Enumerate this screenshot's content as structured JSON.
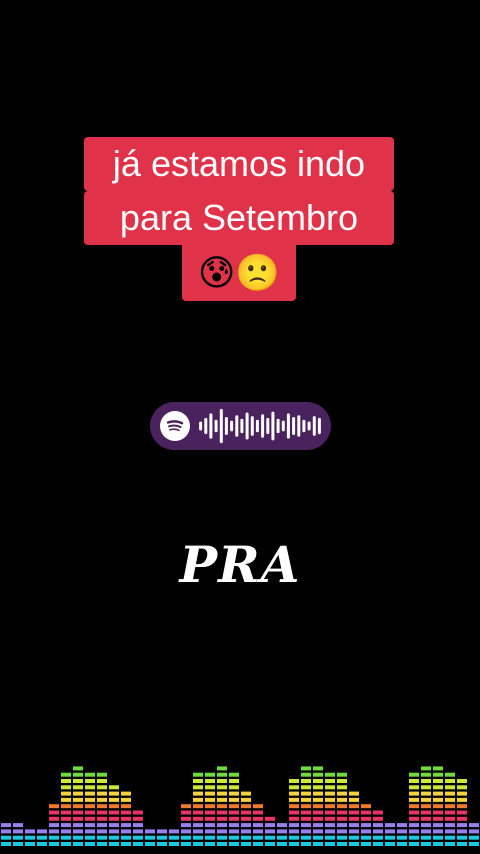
{
  "top_emojis": "😂😅",
  "caption": {
    "line1": "já estamos indo",
    "line2": "para Setembro",
    "emojis": "😰🙁"
  },
  "spotify_code": {
    "icon": "spotify-icon",
    "bar_levels": [
      0.25,
      0.45,
      0.7,
      0.35,
      0.95,
      0.5,
      0.3,
      0.6,
      0.4,
      0.75,
      0.55,
      0.35,
      0.65,
      0.45,
      0.8,
      0.4,
      0.3,
      0.7,
      0.5,
      0.6,
      0.35,
      0.25,
      0.55,
      0.45
    ],
    "background": "#4a235e"
  },
  "lyric": "PRA",
  "equalizer": {
    "colors": [
      "#1ac9e0",
      "#9a7ff0",
      "#e8336a",
      "#f07a2a",
      "#f5d23a",
      "#cde83a",
      "#6edc3a",
      "#2ad14a"
    ],
    "levels": [
      4,
      4,
      3,
      3,
      7,
      12,
      13,
      12,
      12,
      10,
      9,
      6,
      3,
      3,
      3,
      7,
      12,
      12,
      13,
      12,
      9,
      7,
      5,
      4,
      11,
      13,
      13,
      12,
      12,
      9,
      7,
      6,
      4,
      4,
      12,
      13,
      13,
      12,
      11,
      4
    ]
  }
}
